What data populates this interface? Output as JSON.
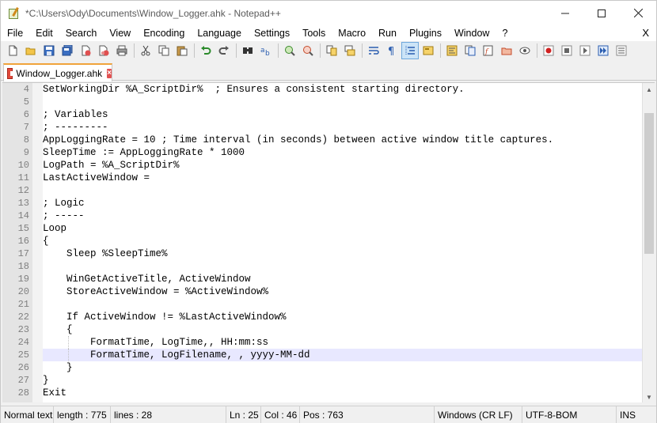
{
  "window": {
    "title": "*C:\\Users\\Ody\\Documents\\Window_Logger.ahk - Notepad++",
    "controls": {
      "minimize": "minimize",
      "maximize": "maximize",
      "close": "close"
    }
  },
  "menu": {
    "items": [
      "File",
      "Edit",
      "Search",
      "View",
      "Encoding",
      "Language",
      "Settings",
      "Tools",
      "Macro",
      "Run",
      "Plugins",
      "Window",
      "?"
    ],
    "close_label": "X"
  },
  "toolbar": {
    "icons": [
      "new-file-icon",
      "open-file-icon",
      "save-icon",
      "save-all-icon",
      "close-icon",
      "close-all-icon",
      "print-icon",
      "cut-icon",
      "copy-icon",
      "paste-icon",
      "undo-icon",
      "redo-icon",
      "find-icon",
      "replace-icon",
      "zoom-in-icon",
      "zoom-out-icon",
      "sync-vertical-icon",
      "sync-horizontal-icon",
      "word-wrap-icon",
      "show-all-chars-icon",
      "indent-guide-icon",
      "user-defined-language-icon",
      "document-map-icon",
      "document-list-icon",
      "function-list-icon",
      "folder-workspace-icon",
      "monitoring-icon",
      "record-macro-icon",
      "stop-macro-icon",
      "play-macro-icon",
      "run-macro-multiple-icon",
      "save-macro-icon"
    ]
  },
  "tabs": [
    {
      "label": "Window_Logger.ahk",
      "modified": true
    }
  ],
  "editor": {
    "current_line": 25,
    "lines": [
      {
        "num": "4",
        "text": "SetWorkingDir %A_ScriptDir%  ; Ensures a consistent starting directory."
      },
      {
        "num": "5",
        "text": ""
      },
      {
        "num": "6",
        "text": "; Variables"
      },
      {
        "num": "7",
        "text": "; ---------"
      },
      {
        "num": "8",
        "text": "AppLoggingRate = 10 ; Time interval (in seconds) between active window title captures."
      },
      {
        "num": "9",
        "text": "SleepTime := AppLoggingRate * 1000"
      },
      {
        "num": "10",
        "text": "LogPath = %A_ScriptDir%"
      },
      {
        "num": "11",
        "text": "LastActiveWindow ="
      },
      {
        "num": "12",
        "text": ""
      },
      {
        "num": "13",
        "text": "; Logic"
      },
      {
        "num": "14",
        "text": "; -----"
      },
      {
        "num": "15",
        "text": "Loop"
      },
      {
        "num": "16",
        "text": "{"
      },
      {
        "num": "17",
        "text": "    Sleep %SleepTime%"
      },
      {
        "num": "18",
        "text": ""
      },
      {
        "num": "19",
        "text": "    WinGetActiveTitle, ActiveWindow"
      },
      {
        "num": "20",
        "text": "    StoreActiveWindow = %ActiveWindow%"
      },
      {
        "num": "21",
        "text": ""
      },
      {
        "num": "22",
        "text": "    If ActiveWindow != %LastActiveWindow%"
      },
      {
        "num": "23",
        "text": "    {"
      },
      {
        "num": "24",
        "text": "        FormatTime, LogTime,, HH:mm:ss"
      },
      {
        "num": "25",
        "text": "        FormatTime, LogFilename, , yyyy-MM-dd"
      },
      {
        "num": "26",
        "text": "    }"
      },
      {
        "num": "27",
        "text": "}"
      },
      {
        "num": "28",
        "text": "Exit"
      }
    ]
  },
  "status": {
    "file_type": "Normal text",
    "length": "length : 775",
    "lines": "lines : 28",
    "ln": "Ln : 25",
    "col": "Col : 46",
    "pos": "Pos : 763",
    "eol": "Windows (CR LF)",
    "encoding": "UTF-8-BOM",
    "mode": "INS"
  }
}
